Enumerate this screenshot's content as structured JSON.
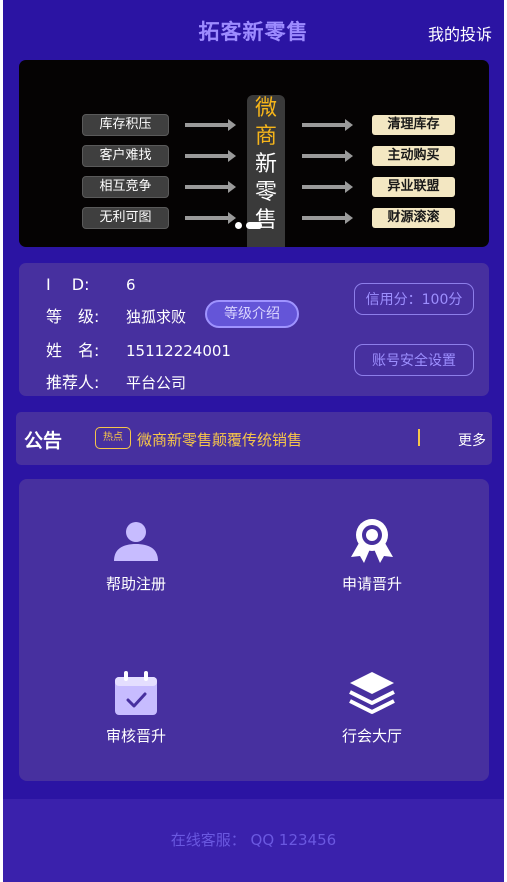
{
  "header": {
    "title": "拓客新零售",
    "complaint": "我的投诉"
  },
  "banner": {
    "left_items": [
      "库存积压",
      "客户难找",
      "相互竞争",
      "无利可图"
    ],
    "center_chars": [
      "微",
      "商",
      "新",
      "零",
      "售"
    ],
    "right_items": [
      "清理库存",
      "主动购买",
      "异业联盟",
      "财源滚滚"
    ],
    "active_slide": 2
  },
  "user": {
    "id_label": "I　 D:",
    "id_value": "6",
    "level_label": "等　级:",
    "level_value": "独孤求败",
    "level_button": "等级介绍",
    "name_label": "姓　名:",
    "name_value": "15112224001",
    "referrer_label": "推荐人:",
    "referrer_value": "平台公司",
    "credit_button": "信用分：100分",
    "security_button": "账号安全设置"
  },
  "notice": {
    "label": "公告",
    "hot_tag": "热点",
    "text": "微商新零售颠覆传统销售",
    "more": "更多"
  },
  "menu": {
    "help_register": "帮助注册",
    "apply_promotion": "申请晋升",
    "review_promotion": "审核晋升",
    "guild_hall": "行会大厅"
  },
  "footer": {
    "service": "在线客服：  QQ 123456"
  },
  "colors": {
    "background": "#2b14a3",
    "panel": "#47309f",
    "accent": "#9d8bff",
    "highlight": "#f6c54a"
  }
}
